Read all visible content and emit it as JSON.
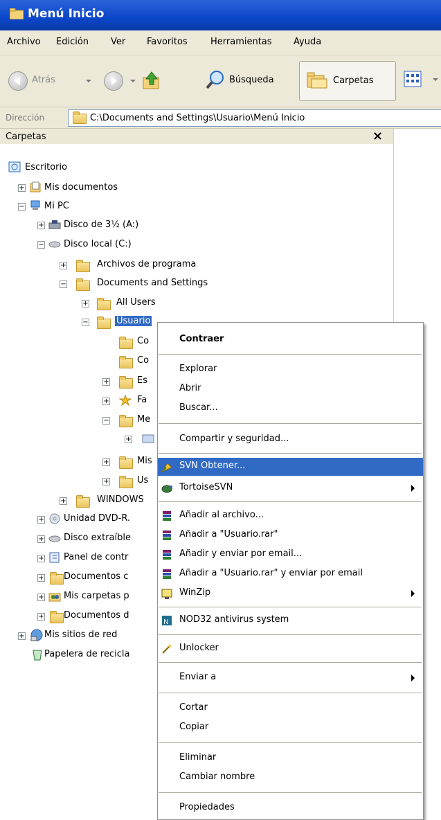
{
  "window": {
    "title": "Menú Inicio"
  },
  "menubar": [
    "Archivo",
    "Edición",
    "Ver",
    "Favoritos",
    "Herramientas",
    "Ayuda"
  ],
  "toolbar": {
    "back": "Atrás",
    "search": "Búsqueda",
    "folders": "Carpetas"
  },
  "address": {
    "label": "Dirección",
    "path": "C:\\Documents and Settings\\Usuario\\Menú Inicio"
  },
  "folders_panel": {
    "title": "Carpetas",
    "close": "×"
  },
  "tree": [
    "Escritorio",
    "Mis documentos",
    "Mi PC",
    "Disco de 3½ (A:)",
    "Disco local (C:)",
    "Archivos de programa",
    "Documents and Settings",
    "All Users",
    "Usuario",
    "Co",
    "Co",
    "Es",
    "Fa",
    "Me",
    "Mis",
    "Us",
    "WINDOWS",
    "Unidad DVD-R.",
    "Disco extraíble",
    "Panel de contr",
    "Documentos c",
    "Mis carpetas p",
    "Documentos d",
    "Mis sitios de red",
    "Papelera de recicla"
  ],
  "context_menu": {
    "contraer": "Contraer",
    "explorar": "Explorar",
    "abrir": "Abrir",
    "buscar": "Buscar...",
    "compartir": "Compartir y seguridad...",
    "svn_obtener": "SVN Obtener...",
    "tortoise": "TortoiseSVN",
    "anadir_archivo": "Añadir al archivo...",
    "anadir_rar": "Añadir a \"Usuario.rar\"",
    "anadir_email": "Añadir y enviar por email...",
    "anadir_rar_email": "Añadir a \"Usuario.rar\" y enviar por email",
    "winzip": "WinZip",
    "nod32": "NOD32 antivirus system",
    "unlocker": "Unlocker",
    "enviar": "Enviar a",
    "cortar": "Cortar",
    "copiar": "Copiar",
    "eliminar": "Eliminar",
    "cambiar": "Cambiar nombre",
    "propiedades": "Propiedades"
  }
}
